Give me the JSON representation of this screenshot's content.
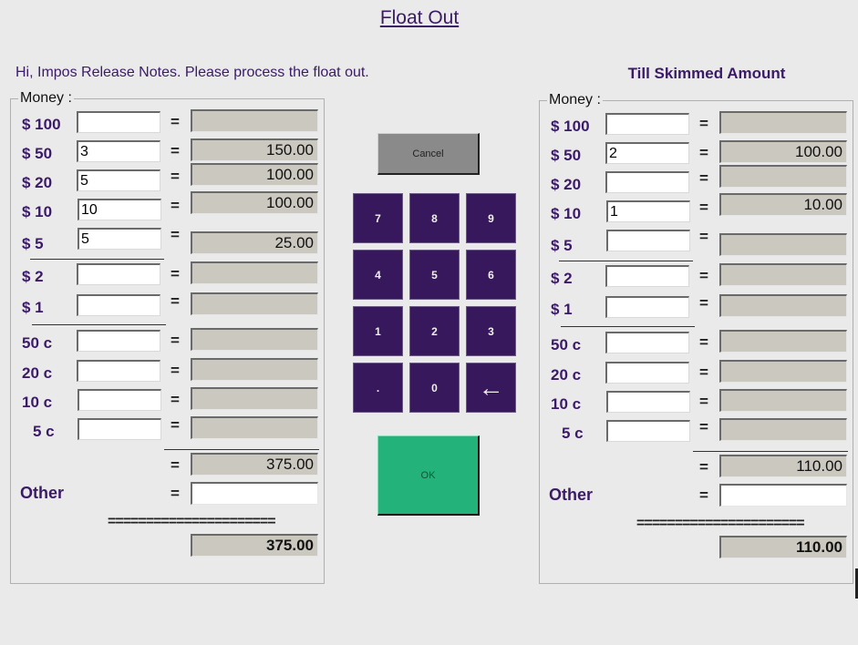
{
  "title": "Float Out",
  "greeting": "Hi, Impos Release Notes. Please process the float out.",
  "colors": {
    "accent": "#3b1a67",
    "keypad": "#37185c",
    "ok": "#22b27a",
    "cancel": "#8a8a8a",
    "readonly_field": "#cbc8bf"
  },
  "left_panel": {
    "legend": "Money :",
    "rows": [
      {
        "label": "$ 100",
        "qty": "",
        "amount": ""
      },
      {
        "label": "$ 50",
        "qty": "3",
        "amount": "150.00"
      },
      {
        "label": "$ 20",
        "qty": "5",
        "amount": "100.00"
      },
      {
        "label": "$ 10",
        "qty": "10",
        "amount": "100.00"
      },
      {
        "label": "$ 5",
        "qty": "5",
        "amount": "25.00"
      },
      {
        "label": "$ 2",
        "qty": "",
        "amount": ""
      },
      {
        "label": "$ 1",
        "qty": "",
        "amount": ""
      },
      {
        "label": "50 c",
        "qty": "",
        "amount": ""
      },
      {
        "label": "20 c",
        "qty": "",
        "amount": ""
      },
      {
        "label": "10 c",
        "qty": "",
        "amount": ""
      },
      {
        "label": "5 c",
        "qty": "",
        "amount": ""
      }
    ],
    "subtotal": "375.00",
    "other_label": "Other",
    "other_value": "",
    "double_separator": "======================",
    "total": "375.00"
  },
  "right_panel": {
    "heading": "Till Skimmed Amount",
    "legend": "Money :",
    "rows": [
      {
        "label": "$ 100",
        "qty": "",
        "amount": ""
      },
      {
        "label": "$ 50",
        "qty": "2",
        "amount": "100.00"
      },
      {
        "label": "$ 20",
        "qty": "",
        "amount": ""
      },
      {
        "label": "$ 10",
        "qty": "1",
        "amount": "10.00"
      },
      {
        "label": "$ 5",
        "qty": "",
        "amount": ""
      },
      {
        "label": "$ 2",
        "qty": "",
        "amount": ""
      },
      {
        "label": "$ 1",
        "qty": "",
        "amount": ""
      },
      {
        "label": "50 c",
        "qty": "",
        "amount": ""
      },
      {
        "label": "20 c",
        "qty": "",
        "amount": ""
      },
      {
        "label": "10 c",
        "qty": "",
        "amount": ""
      },
      {
        "label": "5 c",
        "qty": "",
        "amount": ""
      }
    ],
    "subtotal": "110.00",
    "other_label": "Other",
    "other_value": "",
    "double_separator": "======================",
    "total": "110.00"
  },
  "equals_sign": "=",
  "buttons": {
    "cancel": "Cancel",
    "ok": "OK"
  },
  "keypad": [
    {
      "label": "7",
      "icon": null
    },
    {
      "label": "8",
      "icon": null
    },
    {
      "label": "9",
      "icon": null
    },
    {
      "label": "4",
      "icon": null
    },
    {
      "label": "5",
      "icon": null
    },
    {
      "label": "6",
      "icon": null
    },
    {
      "label": "1",
      "icon": null
    },
    {
      "label": "2",
      "icon": null
    },
    {
      "label": "3",
      "icon": null
    },
    {
      "label": ".",
      "icon": null
    },
    {
      "label": "0",
      "icon": null
    },
    {
      "label": "←",
      "icon": "backspace-arrow-icon"
    }
  ]
}
